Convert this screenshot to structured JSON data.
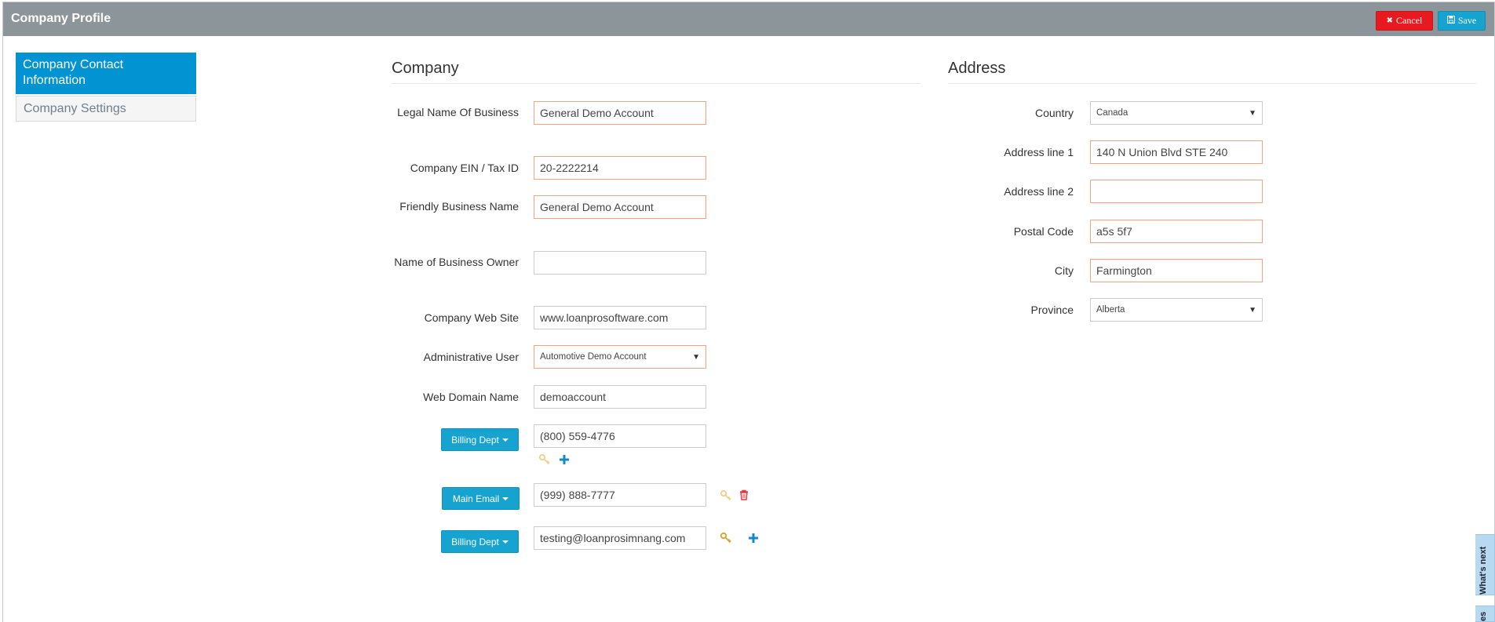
{
  "header": {
    "title": "Company Profile",
    "cancel_label": "Cancel",
    "save_label": "Save"
  },
  "sidebar": {
    "items": [
      {
        "label": "Company Contact Information"
      },
      {
        "label": "Company Settings"
      }
    ]
  },
  "company": {
    "title": "Company",
    "legal_name": {
      "label": "Legal Name Of Business",
      "value": "General Demo Account"
    },
    "ein": {
      "label": "Company EIN / Tax ID",
      "value": "20-2222214"
    },
    "friendly_name": {
      "label": "Friendly Business Name",
      "value": "General Demo Account"
    },
    "owner": {
      "label": "Name of Business Owner",
      "value": ""
    },
    "website": {
      "label": "Company Web Site",
      "value": "www.loanprosoftware.com"
    },
    "admin_user": {
      "label": "Administrative User",
      "value": "Automotive Demo Account"
    },
    "domain": {
      "label": "Web Domain Name",
      "value": "demoaccount"
    },
    "contacts": [
      {
        "type_label": "Billing Dept",
        "value": "(800) 559-4776"
      },
      {
        "type_label": "Main Email",
        "value": "(999) 888-7777"
      },
      {
        "type_label": "Billing Dept",
        "value": "testing@loanprosimnang.com"
      }
    ]
  },
  "address": {
    "title": "Address",
    "country": {
      "label": "Country",
      "value": "Canada"
    },
    "line1": {
      "label": "Address line 1",
      "value": "140 N Union Blvd STE 240"
    },
    "line2": {
      "label": "Address line 2",
      "value": ""
    },
    "postal": {
      "label": "Postal Code",
      "value": "a5s 5f7"
    },
    "city": {
      "label": "City",
      "value": "Farmington"
    },
    "province": {
      "label": "Province",
      "value": "Alberta"
    }
  },
  "side_tabs": {
    "whats_next": "What's next",
    "other": "es"
  },
  "colors": {
    "header_bg": "#8c969a",
    "accent": "#0293d3",
    "cancel": "#e8191f",
    "save": "#16a3cf",
    "required_border": "#f3a382"
  }
}
